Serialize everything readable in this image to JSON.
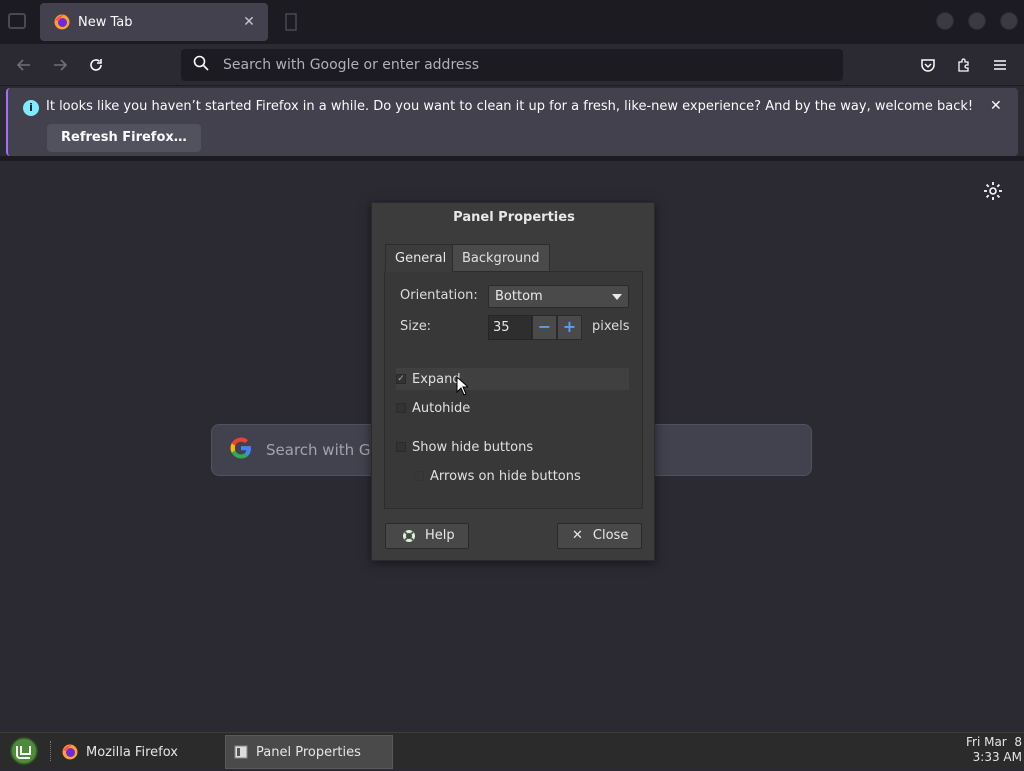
{
  "browser": {
    "tab_title": "New Tab",
    "urlbar_placeholder": "Search with Google or enter address"
  },
  "notification": {
    "message": "It looks like you haven’t started Firefox in a while. Do you want to clean it up for a fresh, like-new experience? And by the way, welcome back!",
    "button": "Refresh Firefox…"
  },
  "newtab": {
    "search_placeholder": "Search with Google or enter address",
    "search_placeholder_visible": "Search with Goo"
  },
  "dialog": {
    "title": "Panel Properties",
    "tabs": [
      "General",
      "Background"
    ],
    "orientation_label": "Orientation:",
    "orientation_value": "Bottom",
    "size_label": "Size:",
    "size_value": "35",
    "size_unit": "pixels",
    "checkboxes": [
      {
        "label": "Expand",
        "checked": true
      },
      {
        "label": "Autohide",
        "checked": false
      },
      {
        "label": "Show hide buttons",
        "checked": false
      },
      {
        "label": "Arrows on hide buttons",
        "checked": false
      }
    ],
    "help_label": "Help",
    "close_label": "Close"
  },
  "taskbar": {
    "items": [
      "Mozilla Firefox",
      "Panel Properties"
    ],
    "clock_date": "Fri Mar  8",
    "clock_time": "3:33 AM"
  },
  "colors": {
    "accent": "#a66efa",
    "info": "#80ebff",
    "spin_button": "#4da3ff"
  }
}
